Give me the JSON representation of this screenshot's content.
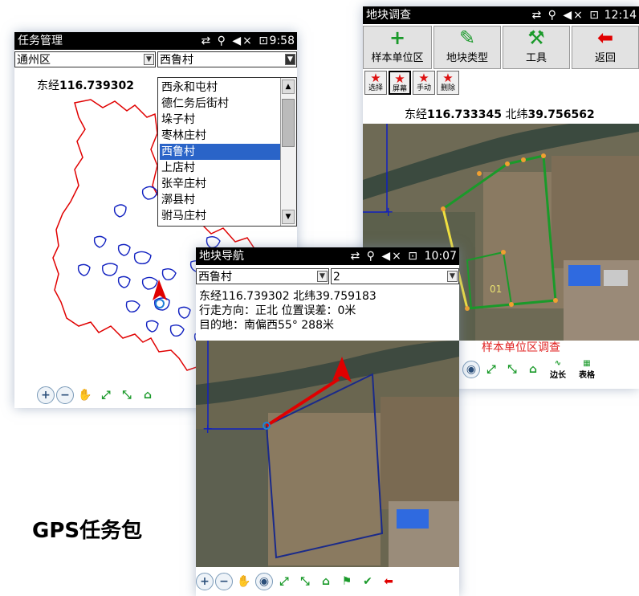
{
  "caption": "GPS任务包",
  "screen1": {
    "title": "任务管理",
    "status_icons": "⇄ ⚲ ◀× ⊡",
    "time": "9:58",
    "district": "通州区",
    "village": "西鲁村",
    "coords_prefix": "东经",
    "coords_value": "116.739302",
    "village_list": [
      "西永和屯村",
      "德仁务后街村",
      "垛子村",
      "枣林庄村",
      "西鲁村",
      "上店村",
      "张辛庄村",
      "漷县村",
      "驸马庄村"
    ],
    "selected_index": 4
  },
  "screen2": {
    "title": "地块调查",
    "status_icons": "⇄ ⚲ ◀× ⊡",
    "time": "12:14",
    "buttons": [
      {
        "label": "样本单位区",
        "icon": "+"
      },
      {
        "label": "地块类型",
        "icon": "✎"
      },
      {
        "label": "工具",
        "icon": "T"
      },
      {
        "label": "返回",
        "icon": "⬅"
      }
    ],
    "star_buttons": [
      "选择",
      "屏幕",
      "手动",
      "删除"
    ],
    "coords_prefix_lon": "东经",
    "coords_lon": "116.733345",
    "coords_prefix_lat": "北纬",
    "coords_lat": "39.756562",
    "parcel_label": "01",
    "footer_label": "样本单位区调查",
    "toolbar_labels": [
      "边长",
      "表格"
    ]
  },
  "screen3": {
    "title": "地块导航",
    "status_icons": "⇄ ⚲ ◀× ⊡",
    "time": "10:07",
    "village": "西鲁村",
    "parcel_no": "2",
    "line1": "东经116.739302 北纬39.759183",
    "line2": "行走方向：正北  位置误差：0米",
    "line3": "目的地：南偏西55°  288米"
  },
  "colors": {
    "boundary_red": "#e00000",
    "parcel_blue": "#1020c0",
    "parcel_green": "#1a9a2a",
    "selection_blue": "#2a64c8"
  }
}
